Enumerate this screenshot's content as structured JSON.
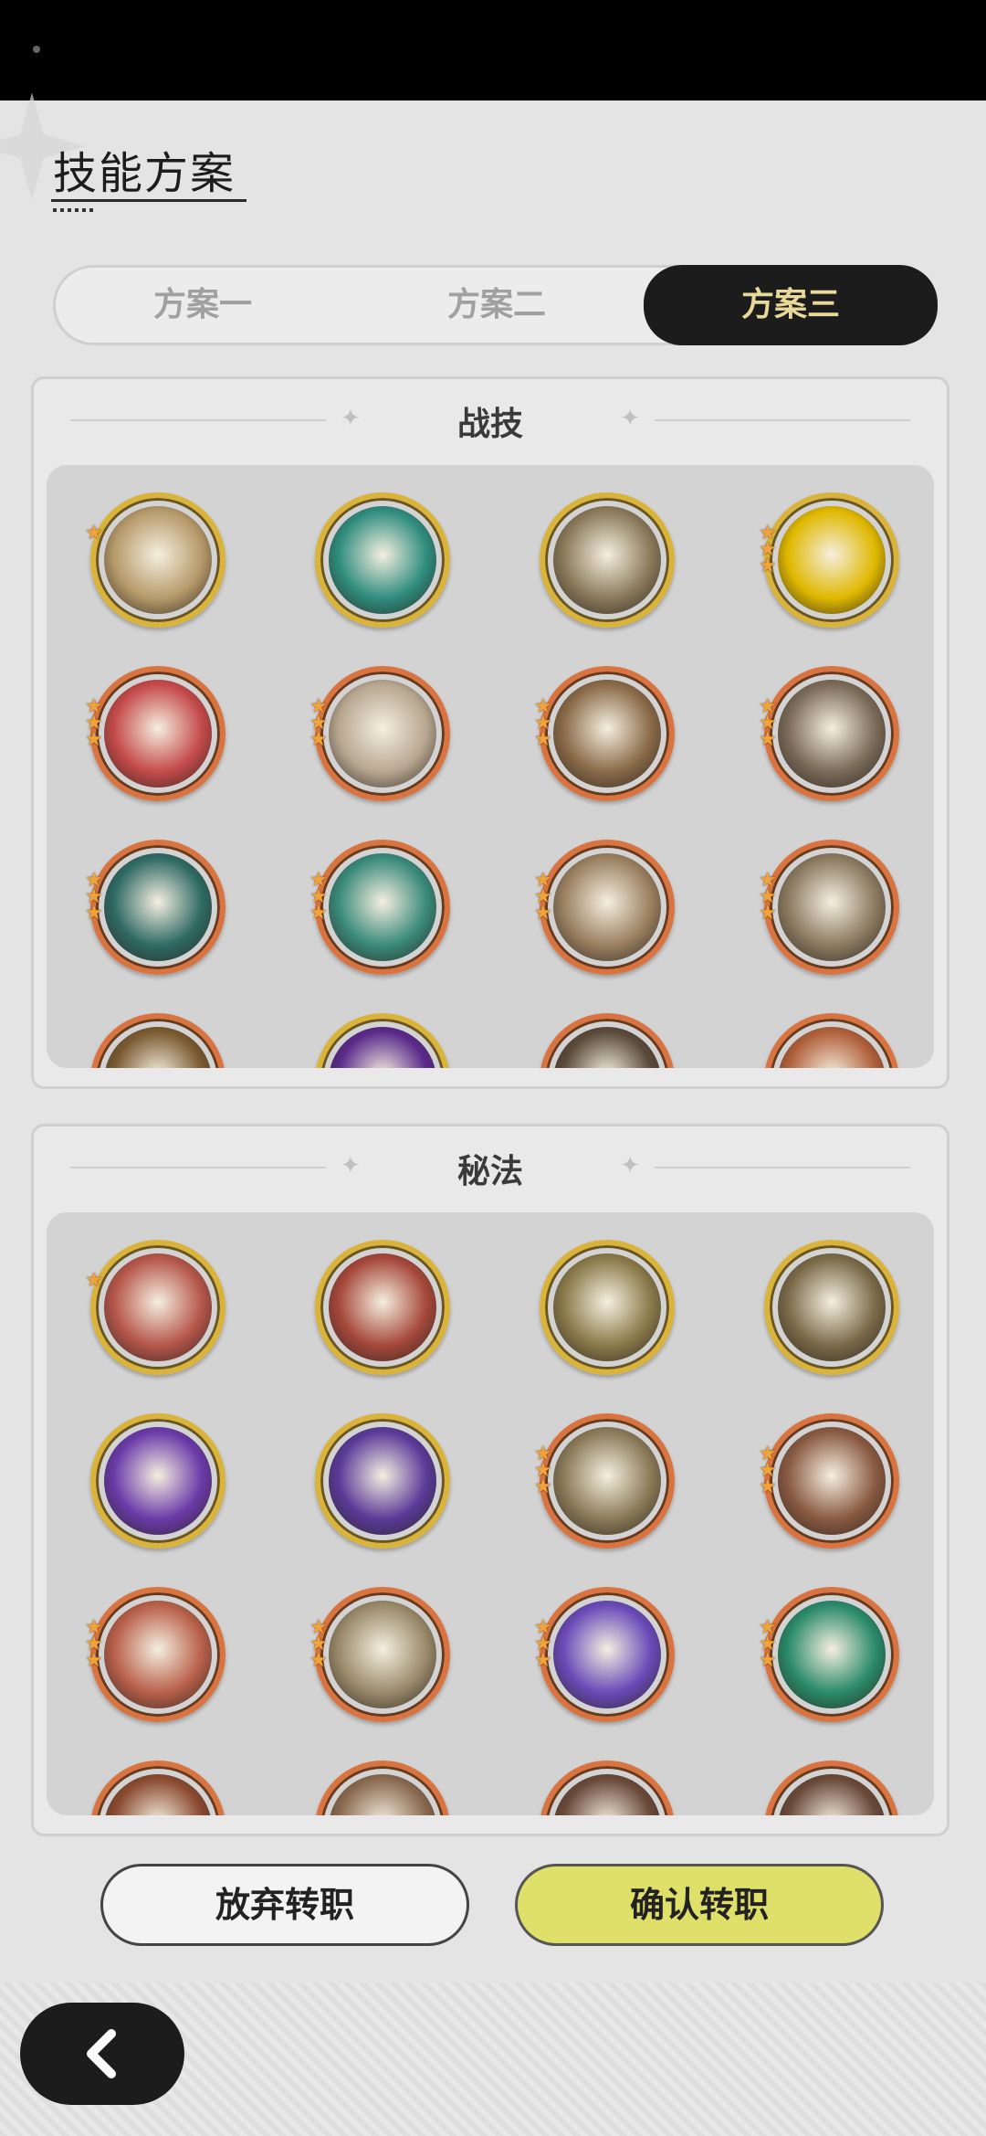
{
  "page": {
    "title": "技能方案"
  },
  "tabs": [
    {
      "label": "方案一",
      "selected": false
    },
    {
      "label": "方案二",
      "selected": false
    },
    {
      "label": "方案三",
      "selected": true
    }
  ],
  "sections": {
    "combat": {
      "title": "战技",
      "icons": [
        {
          "name": "burst-skill-icon",
          "rarity": "gold",
          "stars": 1,
          "color": "#b69a6a"
        },
        {
          "name": "wind-slash-skill-icon",
          "rarity": "gold",
          "stars": 0,
          "color": "#2f8d7e"
        },
        {
          "name": "slash-skill-icon",
          "rarity": "gold",
          "stars": 0,
          "color": "#8a7a5a"
        },
        {
          "name": "power-up-skill-icon",
          "rarity": "gold",
          "stars": 3,
          "color": "#e0b800"
        },
        {
          "name": "blood-strike-skill-icon",
          "rarity": "bronze",
          "stars": 3,
          "color": "#c44a4a"
        },
        {
          "name": "afterimage-skill-icon",
          "rarity": "bronze",
          "stars": 3,
          "color": "#b7a790"
        },
        {
          "name": "crescent-skill-icon",
          "rarity": "bronze",
          "stars": 3,
          "color": "#8a6a48"
        },
        {
          "name": "whirl-attack-skill-icon",
          "rarity": "bronze",
          "stars": 3,
          "color": "#7a6a58"
        },
        {
          "name": "web-skill-icon",
          "rarity": "bronze",
          "stars": 3,
          "color": "#2f6a64"
        },
        {
          "name": "sword-rain-skill-icon",
          "rarity": "bronze",
          "stars": 3,
          "color": "#3a8a7a"
        },
        {
          "name": "blade-strike-skill-icon",
          "rarity": "bronze",
          "stars": 3,
          "color": "#9a8060"
        },
        {
          "name": "tornado-skill-icon",
          "rarity": "bronze",
          "stars": 3,
          "color": "#8a7a60"
        },
        {
          "name": "skill-icon-13",
          "rarity": "bronze",
          "stars": 0,
          "color": "#7a5a30"
        },
        {
          "name": "skill-icon-14",
          "rarity": "gold",
          "stars": 0,
          "color": "#5a2a8a"
        },
        {
          "name": "skill-icon-15",
          "rarity": "bronze",
          "stars": 0,
          "color": "#5a4a3a"
        },
        {
          "name": "skill-icon-16",
          "rarity": "bronze",
          "stars": 0,
          "color": "#b0603a"
        }
      ]
    },
    "arcane": {
      "title": "秘法",
      "icons": [
        {
          "name": "fire-fist-arcane-icon",
          "rarity": "gold",
          "stars": 1,
          "color": "#b5564a"
        },
        {
          "name": "armor-arcane-icon",
          "rarity": "gold",
          "stars": 0,
          "color": "#a5483a"
        },
        {
          "name": "spirit-arcane-icon",
          "rarity": "gold",
          "stars": 0,
          "color": "#8a7a4a"
        },
        {
          "name": "vortex-arcane-icon",
          "rarity": "gold",
          "stars": 0,
          "color": "#7a6a48"
        },
        {
          "name": "purple-flame-arcane-icon",
          "rarity": "gold",
          "stars": 0,
          "color": "#6a3aa8"
        },
        {
          "name": "shadow-beast-arcane-icon",
          "rarity": "gold",
          "stars": 0,
          "color": "#5a3a98"
        },
        {
          "name": "dragon-arcane-icon",
          "rarity": "bronze",
          "stars": 3,
          "color": "#8a7a58"
        },
        {
          "name": "shield-arcane-icon",
          "rarity": "bronze",
          "stars": 3,
          "color": "#8a5a42"
        },
        {
          "name": "flag-arcane-icon",
          "rarity": "bronze",
          "stars": 3,
          "color": "#b8604a"
        },
        {
          "name": "sword-boost-arcane-icon",
          "rarity": "bronze",
          "stars": 3,
          "color": "#9a8a6a"
        },
        {
          "name": "dark-spirit-arcane-icon",
          "rarity": "bronze",
          "stars": 3,
          "color": "#6a4ab8"
        },
        {
          "name": "green-blade-arcane-icon",
          "rarity": "bronze",
          "stars": 3,
          "color": "#2a8a6a"
        },
        {
          "name": "arcane-icon-13",
          "rarity": "bronze",
          "stars": 0,
          "color": "#8a4a30"
        },
        {
          "name": "arcane-icon-14",
          "rarity": "bronze",
          "stars": 0,
          "color": "#8a6a50"
        },
        {
          "name": "arcane-icon-15",
          "rarity": "bronze",
          "stars": 0,
          "color": "#6a4a3a"
        },
        {
          "name": "arcane-icon-16",
          "rarity": "bronze",
          "stars": 0,
          "color": "#6a4a3a"
        }
      ]
    }
  },
  "buttons": {
    "abandon": "放弃转职",
    "confirm": "确认转职"
  },
  "icons": {
    "back": "back-arrow-icon"
  },
  "colors": {
    "accent": "#dfe06a",
    "selected_tab_bg": "#1c1c1c",
    "selected_tab_text": "#e8d89a"
  }
}
